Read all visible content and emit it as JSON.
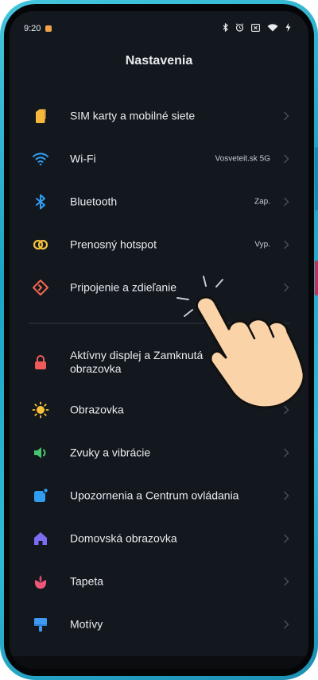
{
  "status_bar": {
    "time": "9:20"
  },
  "header": {
    "title": "Nastavenia"
  },
  "settings": [
    {
      "label": "SIM karty a mobilné siete",
      "value": "",
      "icon": "sim-icon",
      "color": "#f6b73c"
    },
    {
      "label": "Wi-Fi",
      "value": "Vosveteit.sk 5G",
      "icon": "wifi-icon",
      "color": "#2f9ef2"
    },
    {
      "label": "Bluetooth",
      "value": "Zap.",
      "icon": "bluetooth-icon",
      "color": "#2f9ef2"
    },
    {
      "label": "Prenosný hotspot",
      "value": "Vyp.",
      "icon": "hotspot-icon",
      "color": "#f2c23c"
    },
    {
      "label": "Pripojenie a zdieľanie",
      "value": "",
      "icon": "sharing-icon",
      "color": "#f0674f"
    },
    {
      "label": "Aktívny displej a Zamknutá obrazovka",
      "value": "",
      "icon": "lock-icon",
      "color": "#ef5a5a"
    },
    {
      "label": "Obrazovka",
      "value": "",
      "icon": "sun-icon",
      "color": "#f7c23a"
    },
    {
      "label": "Zvuky a vibrácie",
      "value": "",
      "icon": "speaker-icon",
      "color": "#46c46e"
    },
    {
      "label": "Upozornenia a Centrum ovládania",
      "value": "",
      "icon": "notification-icon",
      "color": "#2f9ef2"
    },
    {
      "label": "Domovská obrazovka",
      "value": "",
      "icon": "home-icon",
      "color": "#7b6cf2"
    },
    {
      "label": "Tapeta",
      "value": "",
      "icon": "flower-icon",
      "color": "#f0567a"
    },
    {
      "label": "Motívy",
      "value": "",
      "icon": "brush-icon",
      "color": "#3f9af2"
    }
  ]
}
